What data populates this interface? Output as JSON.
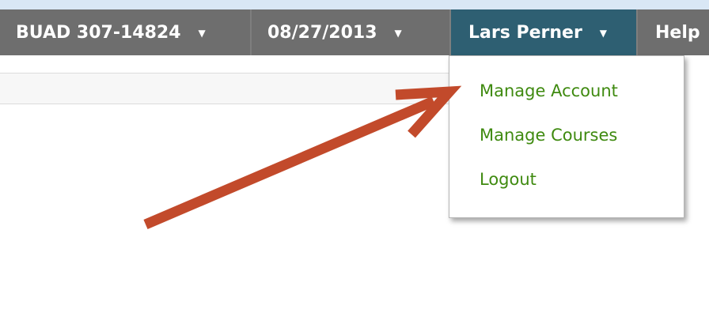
{
  "nav": {
    "course": "BUAD 307-14824",
    "date": "08/27/2013",
    "user": "Lars Perner",
    "help": "Help",
    "caret": "▼"
  },
  "user_menu": {
    "items": [
      "Manage Account",
      "Manage Courses",
      "Logout"
    ]
  },
  "colors": {
    "navbar": "#6e6e6e",
    "active_tab": "#2e5f72",
    "menu_link": "#3f8a10",
    "annotation_arrow": "#c24a2b"
  },
  "icons": [
    "chevron-down-icon",
    "annotation-arrow-icon"
  ]
}
